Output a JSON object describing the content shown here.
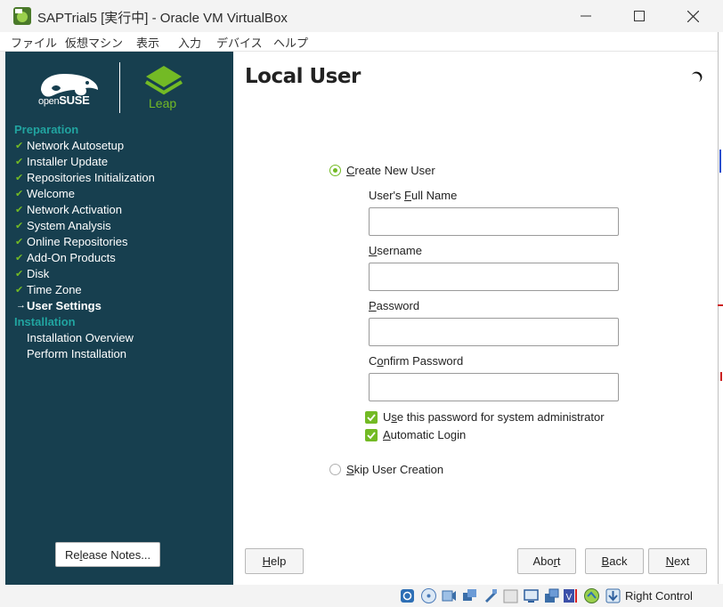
{
  "window": {
    "title": "SAPTrial5 [実行中] - Oracle VM VirtualBox"
  },
  "menu": [
    "ファイル",
    "仮想マシン",
    "表示",
    "入力",
    "デバイス",
    "ヘルプ"
  ],
  "branding": {
    "opensuse": "open",
    "opensuse_bold": "SUSE",
    "leap": "Leap"
  },
  "steps": {
    "preparation_label": "Preparation",
    "preparation": [
      "Network Autosetup",
      "Installer Update",
      "Repositories Initialization",
      "Welcome",
      "Network Activation",
      "System Analysis",
      "Online Repositories",
      "Add-On Products",
      "Disk",
      "Time Zone"
    ],
    "current": "User Settings",
    "installation_label": "Installation",
    "installation": [
      "Installation Overview",
      "Perform Installation"
    ]
  },
  "release_notes": {
    "pre": "Re",
    "ul": "l",
    "post": "ease Notes..."
  },
  "page_title": "Local User",
  "create_user": {
    "pre": "",
    "ul": "C",
    "post": "reate New User",
    "selected": true
  },
  "fields": {
    "full_name": {
      "pre": "User's ",
      "ul": "F",
      "post": "ull Name",
      "value": ""
    },
    "username": {
      "pre": "",
      "ul": "U",
      "post": "sername",
      "value": ""
    },
    "password": {
      "pre": "",
      "ul": "P",
      "post": "assword",
      "value": ""
    },
    "confirm": {
      "pre": "C",
      "ul": "o",
      "post": "nfirm Password",
      "value": ""
    }
  },
  "checks": {
    "use_password": {
      "pre": "U",
      "ul": "s",
      "post": "e this password for system administrator",
      "checked": true
    },
    "auto_login": {
      "pre": "",
      "ul": "A",
      "post": "utomatic Login",
      "checked": true
    }
  },
  "skip_user": {
    "pre": "",
    "ul": "S",
    "post": "kip User Creation",
    "selected": false
  },
  "buttons": {
    "help": {
      "pre": "",
      "ul": "H",
      "post": "elp"
    },
    "abort": {
      "pre": "Abo",
      "ul": "r",
      "post": "t"
    },
    "back": {
      "pre": "",
      "ul": "B",
      "post": "ack"
    },
    "next": {
      "pre": "",
      "ul": "N",
      "post": "ext"
    }
  },
  "statusbar": {
    "host_key": "Right Control"
  },
  "colors": {
    "sidebar": "#173f4f",
    "accent_green": "#73ba25",
    "section_teal": "#21a4a0"
  }
}
